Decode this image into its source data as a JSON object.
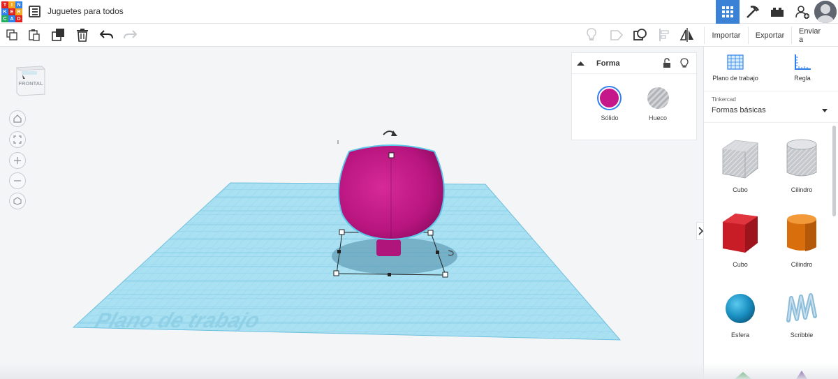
{
  "app": {
    "logo_letters": [
      "T",
      "I",
      "N",
      "K",
      "E",
      "R",
      "C",
      "A",
      "D"
    ],
    "logo_colors": [
      "#e2211c",
      "#f5a623",
      "#2f80ed",
      "#2f80ed",
      "#e2211c",
      "#f5a623",
      "#27ae60",
      "#2f80ed",
      "#e2211c"
    ],
    "document_title": "Juguetes para todos"
  },
  "topbar": {
    "icons": [
      "grid-view-icon",
      "pickaxe-icon",
      "lego-brick-icon",
      "add-user-icon",
      "avatar-icon"
    ],
    "accent": "#3b82d6"
  },
  "toolbar": {
    "left_tools": [
      "copy-icon",
      "paste-icon",
      "duplicate-icon",
      "trash-icon",
      "undo-icon",
      "redo-icon"
    ],
    "right_tools": [
      "light-bulb-icon",
      "shape-note-icon",
      "group-icon",
      "align-icon",
      "mirror-icon"
    ],
    "buttons": {
      "import": "Importar",
      "export": "Exportar",
      "send": "Enviar a"
    }
  },
  "viewcube": {
    "face_label": "FRONTAL"
  },
  "nav_controls": [
    "home-icon",
    "fit-view-icon",
    "zoom-in-icon",
    "zoom-out-icon",
    "orthographic-icon"
  ],
  "workspace": {
    "workplane_label": "Plano de trabajo",
    "grid_color": "#8fd3ec",
    "shape_color": "#c5178a"
  },
  "inspector": {
    "title": "Forma",
    "options": [
      {
        "label": "Sólido",
        "color": "#c5178a"
      },
      {
        "label": "Hueco",
        "color": "#b0b3b7"
      }
    ]
  },
  "right_panel": {
    "tools": [
      {
        "label": "Plano de trabajo",
        "icon": "workplane-icon"
      },
      {
        "label": "Regla",
        "icon": "ruler-icon"
      }
    ],
    "library": {
      "provider": "Tinkercad",
      "selected": "Formas básicas"
    },
    "shapes": [
      {
        "label": "Cubo",
        "icon": "hole-cube-icon",
        "color": "#c5c8cc"
      },
      {
        "label": "Cilindro",
        "icon": "hole-cylinder-icon",
        "color": "#c5c8cc"
      },
      {
        "label": "Cubo",
        "icon": "cube-icon",
        "color": "#d0202a"
      },
      {
        "label": "Cilindro",
        "icon": "cylinder-icon",
        "color": "#e07a10"
      },
      {
        "label": "Esfera",
        "icon": "sphere-icon",
        "color": "#1b95c6"
      },
      {
        "label": "Scribble",
        "icon": "scribble-icon",
        "color": "#7fb7d8"
      }
    ]
  }
}
